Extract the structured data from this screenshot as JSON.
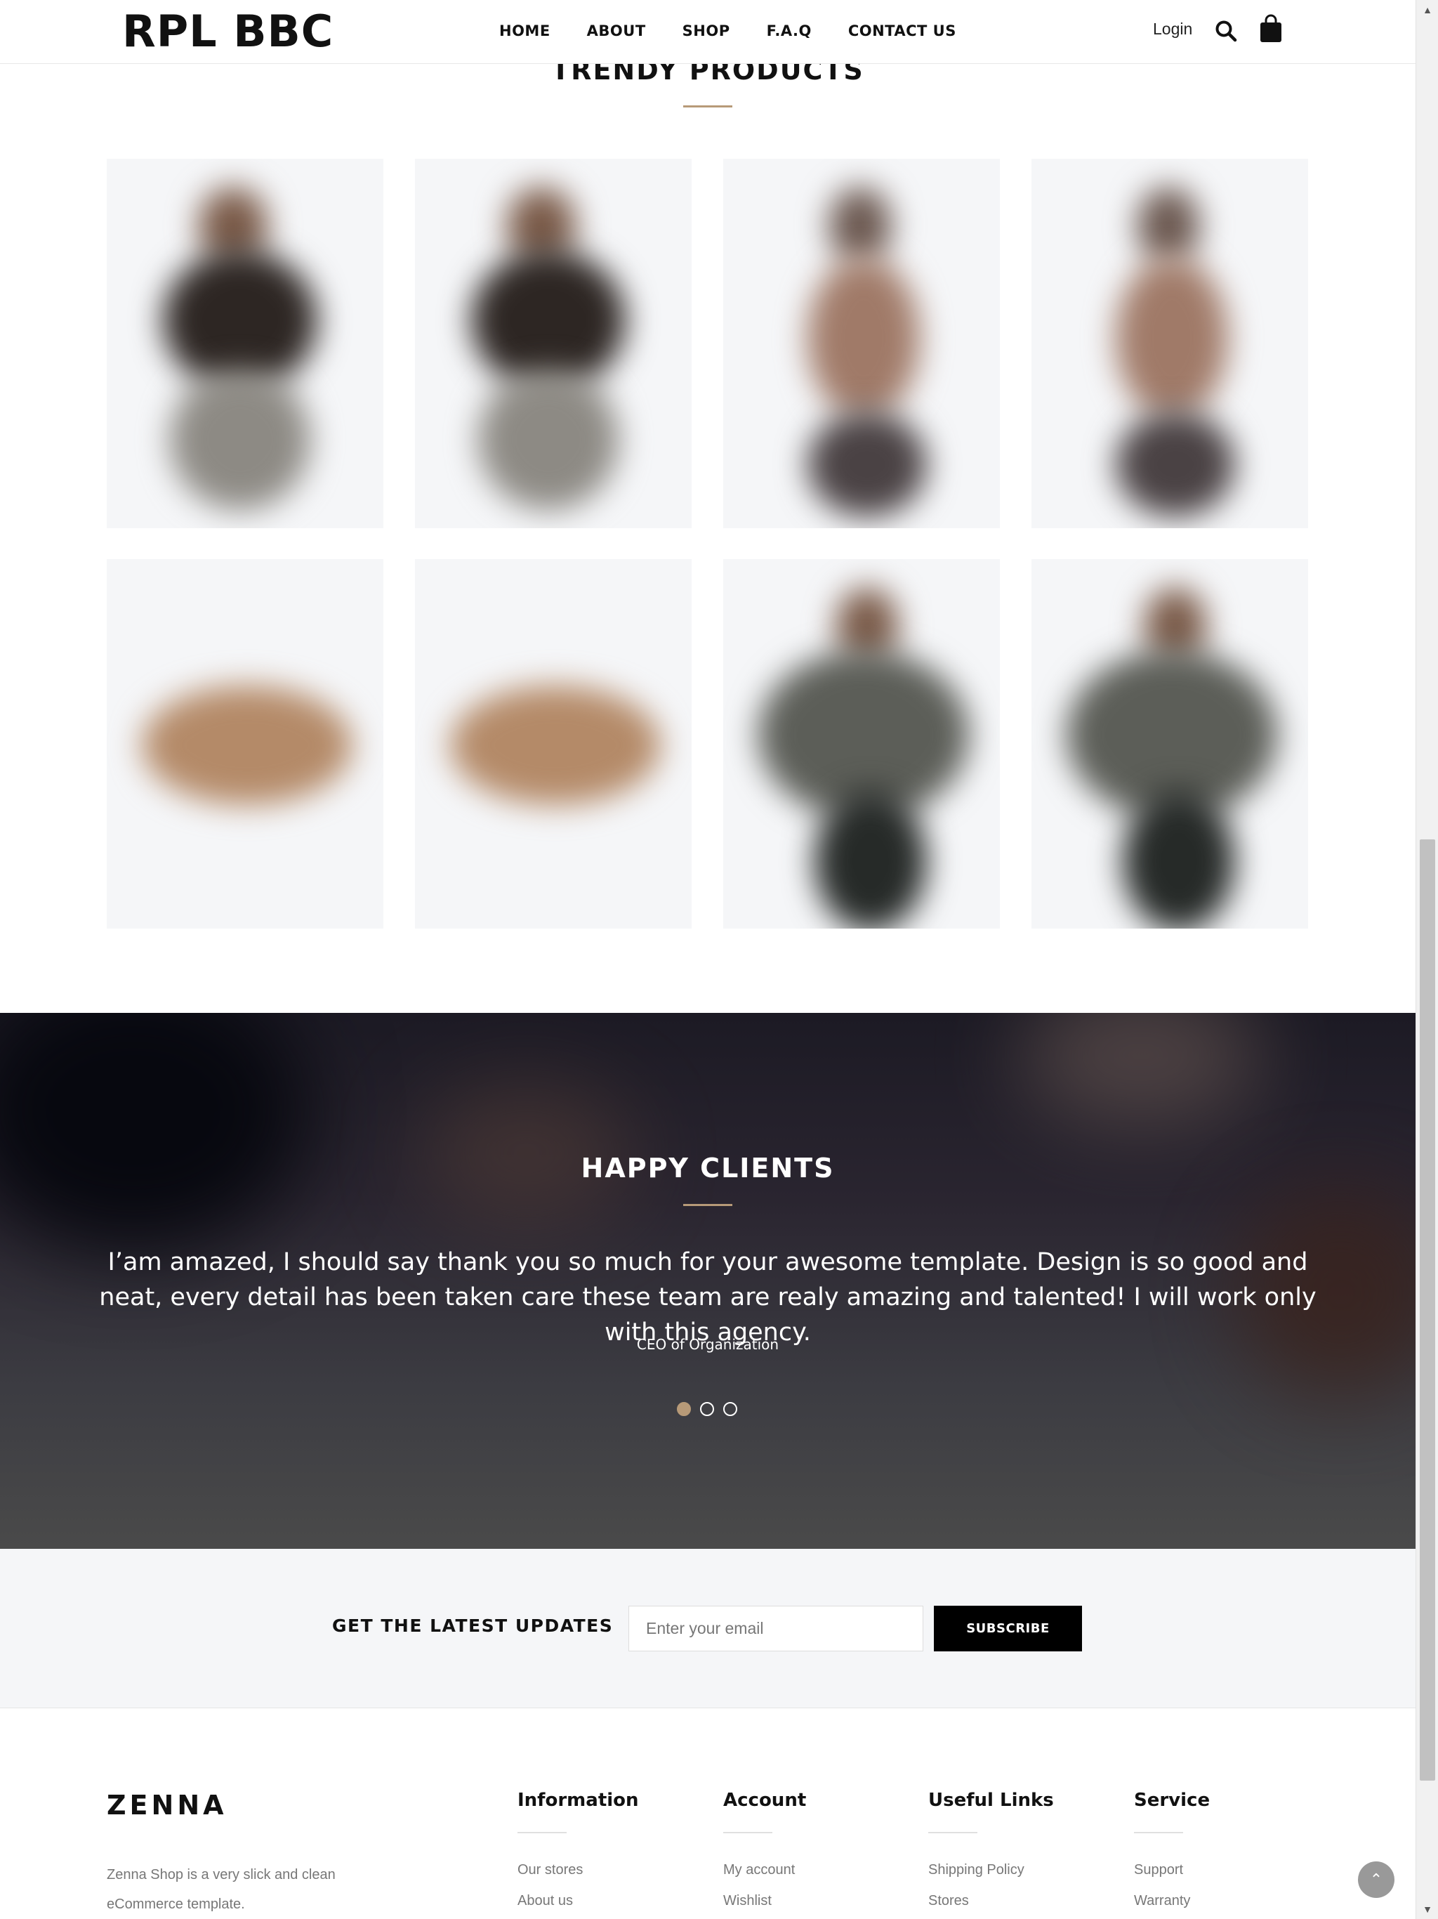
{
  "header": {
    "logo": "RPL BBC",
    "nav": [
      "HOME",
      "ABOUT",
      "SHOP",
      "F.A.Q",
      "CONTACT US"
    ],
    "login": "Login"
  },
  "trendy": {
    "title": "TRENDY PRODUCTS",
    "products": [
      {
        "image": "sweater-model"
      },
      {
        "image": "sweater-model"
      },
      {
        "image": "dress-model"
      },
      {
        "image": "dress-model"
      },
      {
        "image": "sandals"
      },
      {
        "image": "sandals"
      },
      {
        "image": "jacket-model"
      },
      {
        "image": "jacket-model"
      }
    ]
  },
  "clients": {
    "title": "HAPPY CLIENTS",
    "quote": "I’am amazed, I should say thank you so much for your awesome template. Design is so good and neat, every detail has been taken care these team are realy amazing and talented! I will work only with this agency.",
    "role": "CEO of Organization",
    "slides": 3,
    "active_slide": 1
  },
  "newsletter": {
    "label": "GET THE LATEST UPDATES",
    "placeholder": "Enter your email",
    "button": "SUBSCRIBE"
  },
  "footer": {
    "logo": "ZENNA",
    "description": "Zenna Shop is a very slick and clean eCommerce template.",
    "columns": [
      {
        "title": "Information",
        "links": [
          "Our stores",
          "About us"
        ]
      },
      {
        "title": "Account",
        "links": [
          "My account",
          "Wishlist"
        ]
      },
      {
        "title": "Useful Links",
        "links": [
          "Shipping Policy",
          "Stores"
        ]
      },
      {
        "title": "Service",
        "links": [
          "Support",
          "Warranty"
        ]
      }
    ]
  },
  "colors": {
    "accent": "#b79a78",
    "button": "#000000",
    "panel": "#f5f6f8"
  },
  "icons": {
    "search": "search-icon",
    "cart": "shopping-bag-icon",
    "scroll_top": "chevron-up-icon"
  }
}
